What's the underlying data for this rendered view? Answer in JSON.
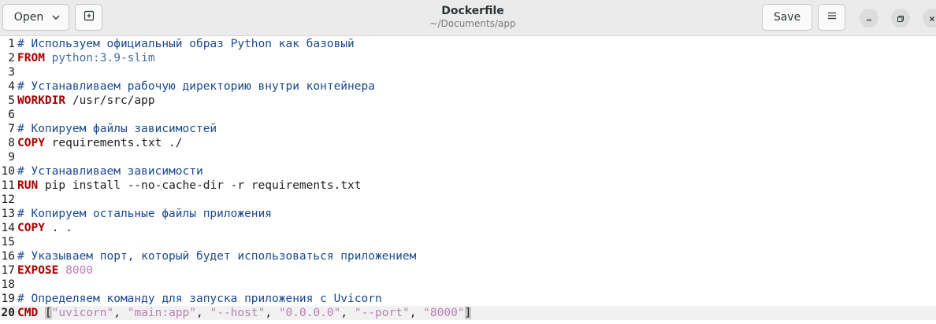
{
  "window": {
    "title": "Dockerfile",
    "subtitle": "~/Documents/app"
  },
  "headerbar": {
    "open_label": "Open",
    "save_label": "Save"
  },
  "editor": {
    "current_line": 20,
    "lines": [
      {
        "n": "1",
        "tokens": [
          {
            "t": "comment",
            "v": "# Используем официальный образ Python как базовый"
          }
        ]
      },
      {
        "n": "2",
        "tokens": [
          {
            "t": "keyword",
            "v": "FROM"
          },
          {
            "t": "plain",
            "v": " "
          },
          {
            "t": "value",
            "v": "python:3.9-slim"
          }
        ]
      },
      {
        "n": "3",
        "tokens": []
      },
      {
        "n": "4",
        "tokens": [
          {
            "t": "comment",
            "v": "# Устанавливаем рабочую директорию внутри контейнера"
          }
        ]
      },
      {
        "n": "5",
        "tokens": [
          {
            "t": "keyword",
            "v": "WORKDIR"
          },
          {
            "t": "plain",
            "v": " /usr/src/app"
          }
        ]
      },
      {
        "n": "6",
        "tokens": []
      },
      {
        "n": "7",
        "tokens": [
          {
            "t": "comment",
            "v": "# Копируем файлы зависимостей"
          }
        ]
      },
      {
        "n": "8",
        "tokens": [
          {
            "t": "keyword",
            "v": "COPY"
          },
          {
            "t": "plain",
            "v": " requirements.txt ./"
          }
        ]
      },
      {
        "n": "9",
        "tokens": []
      },
      {
        "n": "10",
        "tokens": [
          {
            "t": "comment",
            "v": "# Устанавливаем зависимости"
          }
        ]
      },
      {
        "n": "11",
        "tokens": [
          {
            "t": "keyword",
            "v": "RUN"
          },
          {
            "t": "plain",
            "v": " pip install --no-cache-dir -r requirements.txt"
          }
        ]
      },
      {
        "n": "12",
        "tokens": []
      },
      {
        "n": "13",
        "tokens": [
          {
            "t": "comment",
            "v": "# Копируем остальные файлы приложения"
          }
        ]
      },
      {
        "n": "14",
        "tokens": [
          {
            "t": "keyword",
            "v": "COPY"
          },
          {
            "t": "plain",
            "v": " . ."
          }
        ]
      },
      {
        "n": "15",
        "tokens": []
      },
      {
        "n": "16",
        "tokens": [
          {
            "t": "comment",
            "v": "# Указываем порт, который будет использоваться приложением"
          }
        ]
      },
      {
        "n": "17",
        "tokens": [
          {
            "t": "keyword",
            "v": "EXPOSE"
          },
          {
            "t": "plain",
            "v": " "
          },
          {
            "t": "number",
            "v": "8000"
          }
        ]
      },
      {
        "n": "18",
        "tokens": []
      },
      {
        "n": "19",
        "tokens": [
          {
            "t": "comment",
            "v": "# Определяем команду для запуска приложения с Uvicorn"
          }
        ]
      },
      {
        "n": "20",
        "tokens": [
          {
            "t": "keyword",
            "v": "CMD"
          },
          {
            "t": "plain",
            "v": " "
          },
          {
            "t": "bracket-hl",
            "v": "["
          },
          {
            "t": "string",
            "v": "\"uvicorn\""
          },
          {
            "t": "plain",
            "v": ", "
          },
          {
            "t": "string",
            "v": "\"main:app\""
          },
          {
            "t": "plain",
            "v": ", "
          },
          {
            "t": "string",
            "v": "\"--host\""
          },
          {
            "t": "plain",
            "v": ", "
          },
          {
            "t": "string",
            "v": "\"0.0.0.0\""
          },
          {
            "t": "plain",
            "v": ", "
          },
          {
            "t": "string",
            "v": "\"--port\""
          },
          {
            "t": "plain",
            "v": ", "
          },
          {
            "t": "string",
            "v": "\"8000\""
          },
          {
            "t": "bracket-hl",
            "v": "]"
          }
        ]
      }
    ]
  },
  "icons": {
    "open_chevron": "chevron-down-icon",
    "new_tab": "new-tab-icon",
    "menu": "hamburger-menu-icon",
    "minimize": "minimize-icon",
    "maximize": "maximize-icon",
    "close": "close-icon"
  },
  "colors": {
    "comment": "#1a4a8e",
    "keyword": "#a40000",
    "value": "#4a6c9c",
    "string": "#b680b2",
    "current_line_bg": "#f1f1f1"
  }
}
